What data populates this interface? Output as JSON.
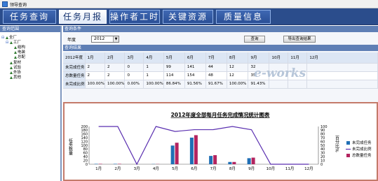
{
  "window": {
    "title": "领导查询"
  },
  "tabs": [
    {
      "label": "任务查询",
      "active": false
    },
    {
      "label": "任务月报",
      "active": true
    },
    {
      "label": "操作者工时",
      "active": false
    },
    {
      "label": "关键资源",
      "active": false
    },
    {
      "label": "质量信息",
      "active": false
    }
  ],
  "sidebar": {
    "title": "查询范围",
    "tree": [
      {
        "label": "全厂",
        "level": 0,
        "expander": "⊟"
      },
      {
        "label": "工厂",
        "level": 1,
        "expander": "⊟"
      },
      {
        "label": "结构",
        "level": 2,
        "expander": ""
      },
      {
        "label": "电装",
        "level": 2,
        "expander": ""
      },
      {
        "label": "总配",
        "level": 2,
        "expander": ""
      },
      {
        "label": "复材",
        "level": 1,
        "expander": ""
      },
      {
        "label": "试验",
        "level": 1,
        "expander": ""
      },
      {
        "label": "外协",
        "level": 1,
        "expander": ""
      },
      {
        "label": "其他",
        "level": 1,
        "expander": ""
      }
    ]
  },
  "conditions": {
    "section_title": "查询条件",
    "year_label": "年度",
    "year_value": "2012",
    "query_button": "查询",
    "export_button": "导出查询结果"
  },
  "results": {
    "section_title": "查询结果",
    "header": [
      "2012年度",
      "1月",
      "2月",
      "3月",
      "4月",
      "5月",
      "6月",
      "7月",
      "8月",
      "9月",
      "10月",
      "11月",
      "12月"
    ],
    "rows": [
      {
        "label": "未完成任务",
        "values": [
          "2",
          "2",
          "0",
          "1",
          "99",
          "141",
          "44",
          "12",
          "32",
          "",
          "",
          ""
        ]
      },
      {
        "label": "总数量任务",
        "values": [
          "2",
          "2",
          "0",
          "1",
          "114",
          "154",
          "48",
          "12",
          "35",
          "",
          "",
          ""
        ]
      },
      {
        "label": "未完成比例",
        "values": [
          "100.00%",
          "100.00%",
          "0.00%",
          "100.00%",
          "86.84%",
          "91.56%",
          "91.67%",
          "100.00%",
          "91.43%",
          "",
          "",
          ""
        ]
      }
    ]
  },
  "chart_data": {
    "type": "bar",
    "title": "2012年度全部每月任务完成情况统计图表",
    "categories": [
      "1月",
      "2月",
      "3月",
      "4月",
      "5月",
      "6月",
      "7月",
      "8月",
      "9月",
      "10月",
      "11月",
      "12月"
    ],
    "ylabel": "任务数量",
    "y2label": "百分比%",
    "ylim": [
      0,
      200
    ],
    "yticks": [
      0,
      20,
      40,
      60,
      80,
      100,
      120,
      140,
      160,
      180,
      200
    ],
    "y2lim": [
      0,
      100
    ],
    "y2ticks": [
      0,
      10,
      20,
      30,
      40,
      50,
      60,
      70,
      80,
      90,
      100
    ],
    "legend_position": "right",
    "series": [
      {
        "name": "未完成任务",
        "kind": "bar",
        "color": "#1f6fb5",
        "values": [
          2,
          2,
          0,
          1,
          99,
          141,
          44,
          12,
          32,
          0,
          0,
          0
        ]
      },
      {
        "name": "未完成比例",
        "kind": "line",
        "axis": "right",
        "color": "#5a2fb0",
        "values": [
          100,
          100,
          0,
          100,
          86.84,
          91.56,
          91.67,
          100,
          91.43,
          0,
          0,
          0
        ]
      },
      {
        "name": "总数量任务",
        "kind": "bar",
        "color": "#b3245f",
        "values": [
          2,
          2,
          0,
          1,
          114,
          154,
          48,
          12,
          35,
          0,
          0,
          0
        ]
      }
    ]
  },
  "watermark": "e-works"
}
